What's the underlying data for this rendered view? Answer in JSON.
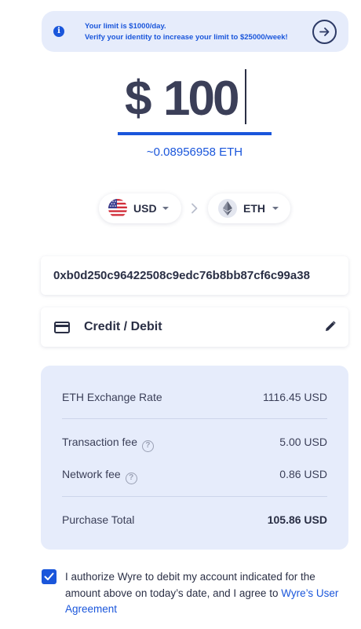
{
  "banner": {
    "line1": "Your limit is $1000/day.",
    "line2": "Verify your identity to increase your limit to $25000/week!",
    "icon": "info-icon",
    "action_icon": "arrow-right-icon"
  },
  "amount": {
    "currency_symbol": "$",
    "value": "100",
    "eth_estimate": "~0.08956958 ETH"
  },
  "currency_pair": {
    "from": {
      "code": "USD",
      "icon": "us-flag-icon"
    },
    "to": {
      "code": "ETH",
      "icon": "ethereum-icon"
    }
  },
  "wallet_address": "0xb0d250c96422508c9edc76b8bb87cf6c99a38",
  "payment_method": {
    "label": "Credit / Debit",
    "icon": "credit-card-icon",
    "edit_icon": "pencil-icon"
  },
  "summary": {
    "exchange_rate": {
      "label": "ETH Exchange Rate",
      "value": "1116.45 USD"
    },
    "transaction_fee": {
      "label": "Transaction fee",
      "value": "5.00 USD",
      "help": "?"
    },
    "network_fee": {
      "label": "Network fee",
      "value": "0.86 USD",
      "help": "?"
    },
    "total": {
      "label": "Purchase Total",
      "value": "105.86 USD"
    }
  },
  "consent": {
    "checked": true,
    "text": "I authorize Wyre to debit my account indicated for the amount above on today’s date, and I agree to ",
    "link_text": "Wyre’s User Agreement"
  },
  "colors": {
    "accent": "#1a56db",
    "panel": "#e6ecfb",
    "text": "#2a2f45"
  }
}
